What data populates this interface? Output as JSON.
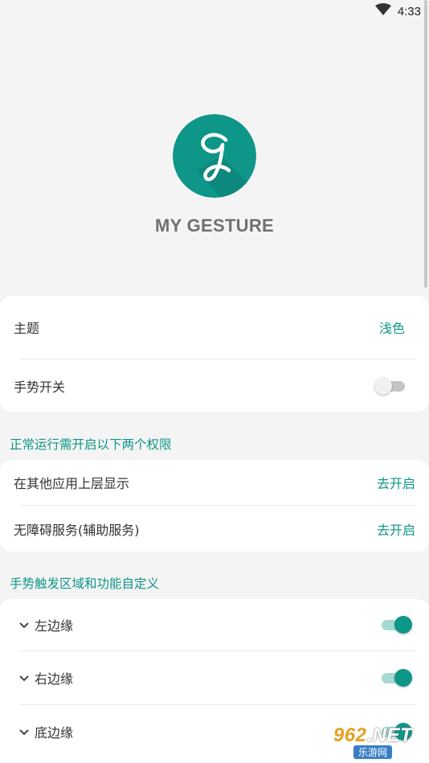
{
  "status_bar": {
    "time": "4:33",
    "wifi_icon": "wifi-icon"
  },
  "app": {
    "title": "MY GESTURE",
    "logo_icon": "gesture-logo-icon",
    "accent": "#0e9688"
  },
  "settings": {
    "theme_label": "主题",
    "theme_value": "浅色",
    "gesture_switch_label": "手势开关",
    "gesture_switch_on": false
  },
  "permissions": {
    "section_title": "正常运行需开启以下两个权限",
    "items": [
      {
        "label": "在其他应用上层显示",
        "action": "去开启"
      },
      {
        "label": "无障碍服务(辅助服务)",
        "action": "去开启"
      }
    ]
  },
  "edges": {
    "section_title": "手势触发区域和功能自定义",
    "items": [
      {
        "label": "左边缘",
        "enabled": true
      },
      {
        "label": "右边缘",
        "enabled": true
      },
      {
        "label": "底边缘",
        "enabled": true
      }
    ]
  },
  "watermark": {
    "top": "962",
    "net": ".NET",
    "bottom": "乐游网"
  }
}
